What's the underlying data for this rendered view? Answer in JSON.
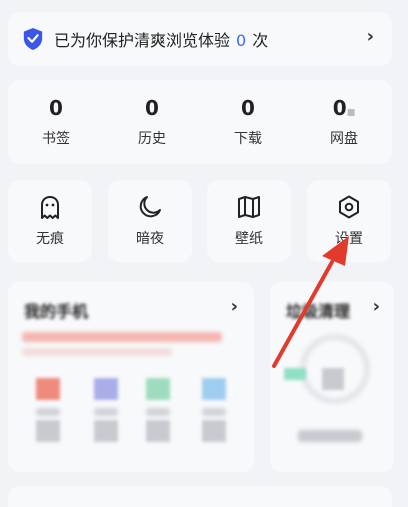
{
  "banner": {
    "prefix": "已为你保护清爽浏览体验",
    "count": "0",
    "suffix": "次",
    "chevron": "›"
  },
  "stats": [
    {
      "value": "0",
      "label": "书签"
    },
    {
      "value": "0",
      "label": "历史"
    },
    {
      "value": "0",
      "label": "下载"
    },
    {
      "value": "0",
      "label": "网盘"
    }
  ],
  "tools": [
    {
      "label": "无痕",
      "icon": "ghost-icon"
    },
    {
      "label": "暗夜",
      "icon": "moon-icon"
    },
    {
      "label": "壁纸",
      "icon": "book-icon"
    },
    {
      "label": "设置",
      "icon": "settings-icon"
    }
  ],
  "my_phone": {
    "title": "我的手机",
    "chevron": "›"
  },
  "cleanup": {
    "title": "垃圾清理",
    "chevron": "›"
  },
  "colors": {
    "accent": "#3b6cf6",
    "arrow": "#e23b2e"
  }
}
